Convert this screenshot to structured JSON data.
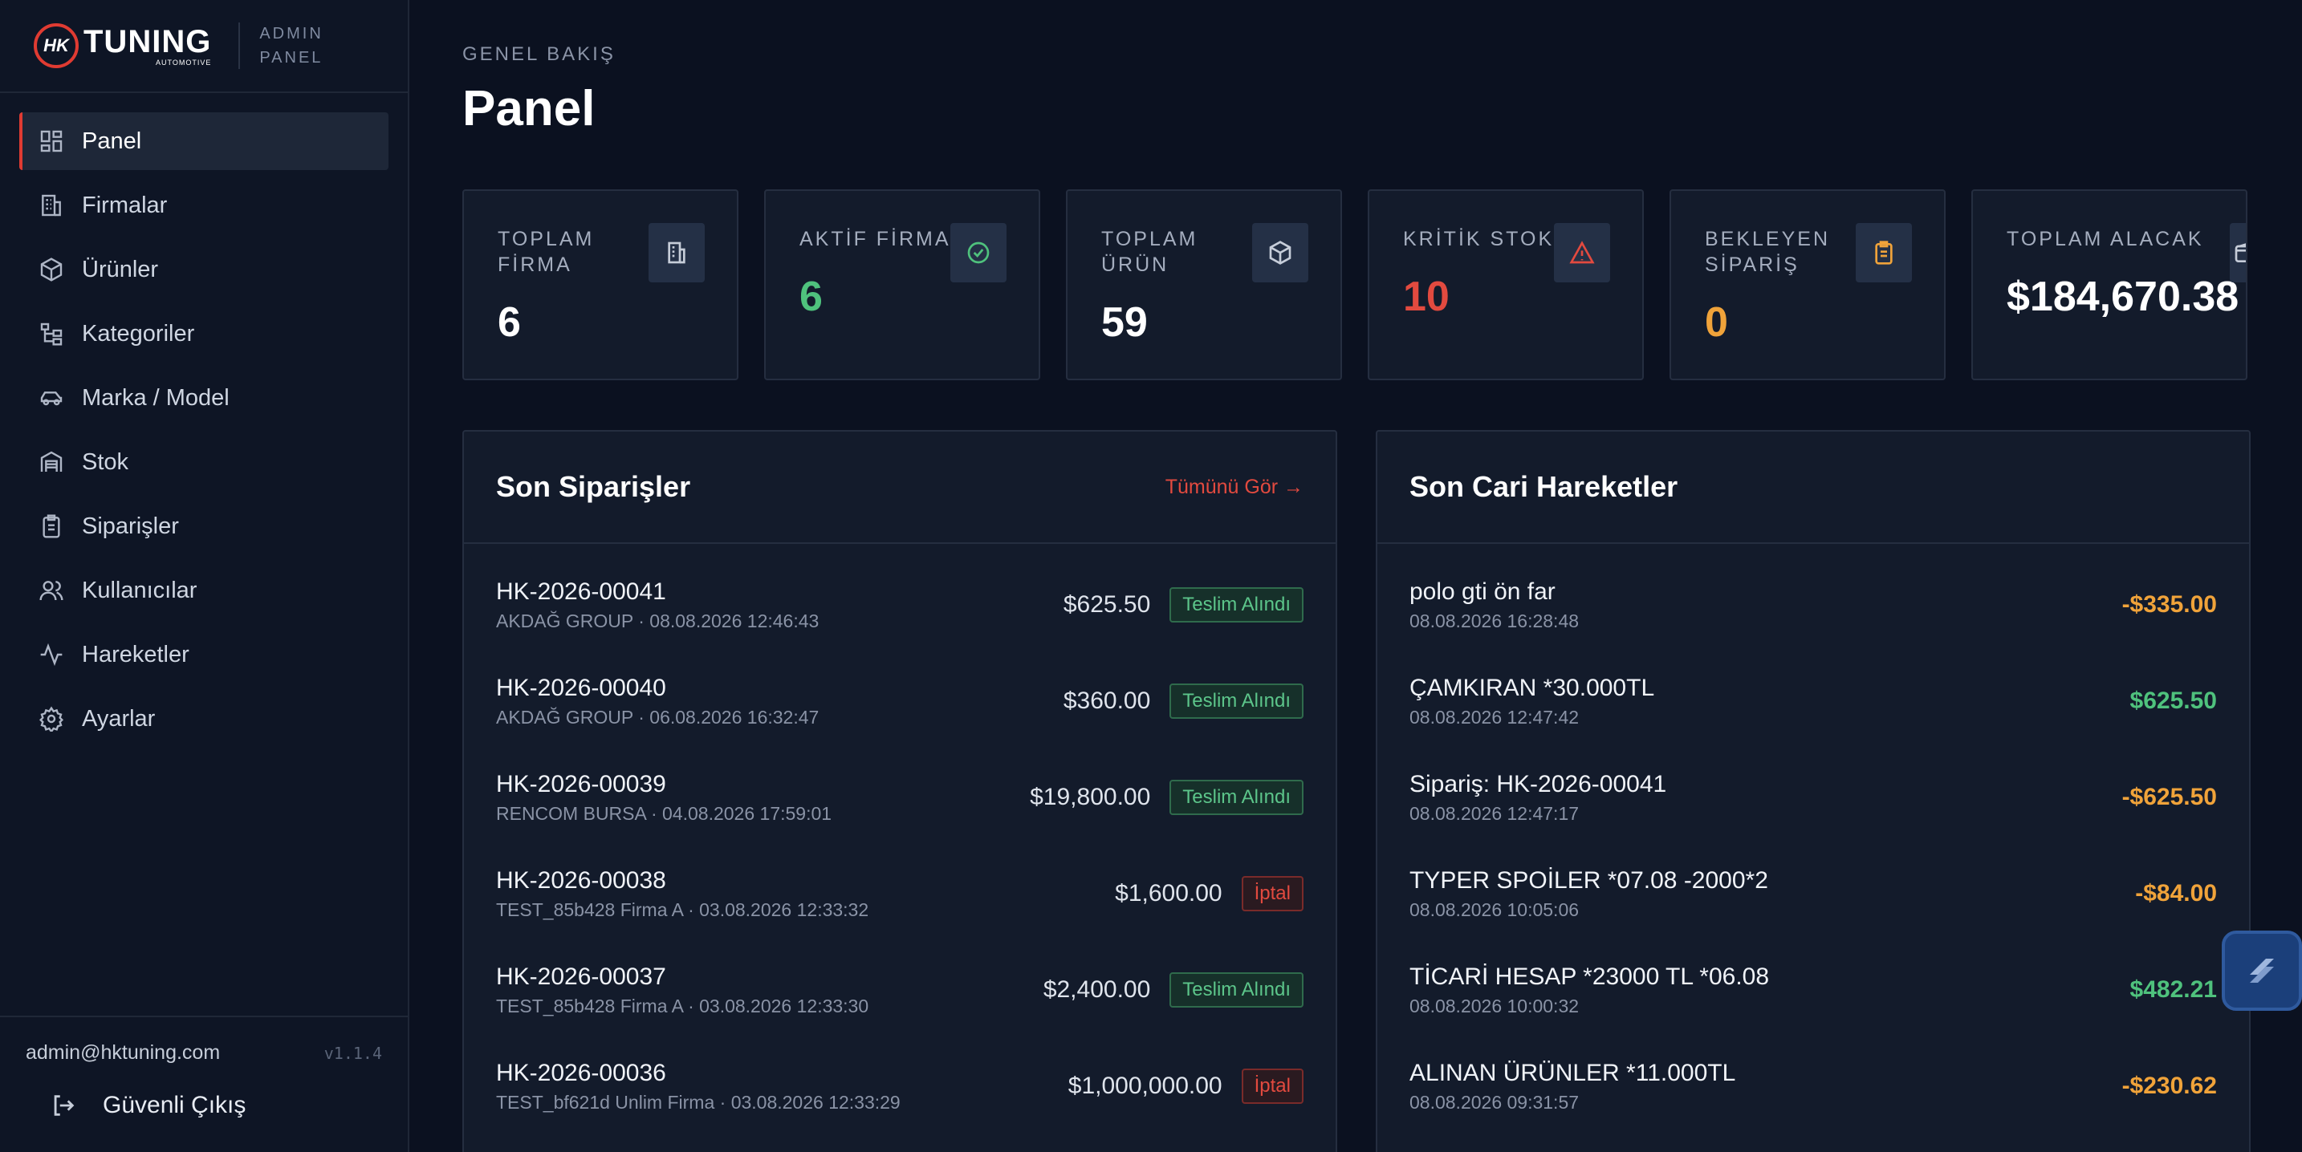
{
  "brand": {
    "logo_mark": "HK",
    "logo_text": "TUNING",
    "logo_sub": "AUTOMOTIVE",
    "caption_line1": "ADMIN",
    "caption_line2": "PANEL",
    "accent": "#e03b32"
  },
  "sidebar": {
    "items": [
      {
        "label": "Panel",
        "icon": "dashboard-icon",
        "active": true
      },
      {
        "label": "Firmalar",
        "icon": "building-icon"
      },
      {
        "label": "Ürünler",
        "icon": "box-icon"
      },
      {
        "label": "Kategoriler",
        "icon": "category-tree-icon"
      },
      {
        "label": "Marka / Model",
        "icon": "car-icon"
      },
      {
        "label": "Stok",
        "icon": "warehouse-icon"
      },
      {
        "label": "Siparişler",
        "icon": "clipboard-icon"
      },
      {
        "label": "Kullanıcılar",
        "icon": "users-icon"
      },
      {
        "label": "Hareketler",
        "icon": "activity-icon"
      },
      {
        "label": "Ayarlar",
        "icon": "gear-icon"
      }
    ],
    "user_email": "admin@hktuning.com",
    "version": "v1.1.4",
    "logout_label": "Güvenli Çıkış"
  },
  "header": {
    "breadcrumb": "GENEL BAKIŞ",
    "title": "Panel"
  },
  "stats": [
    {
      "label": "TOPLAM FİRMA",
      "value": "6",
      "color": "#ffffff",
      "icon": "building-icon"
    },
    {
      "label": "AKTİF FİRMA",
      "value": "6",
      "color": "#4fc27d",
      "icon": "check-circle-icon"
    },
    {
      "label": "TOPLAM ÜRÜN",
      "value": "59",
      "color": "#ffffff",
      "icon": "box-icon"
    },
    {
      "label": "KRİTİK STOK",
      "value": "10",
      "color": "#e24a3f",
      "icon": "warning-icon"
    },
    {
      "label": "BEKLEYEN SİPARİŞ",
      "value": "0",
      "color": "#f0a33a",
      "icon": "clipboard-icon"
    },
    {
      "label": "TOPLAM ALACAK",
      "value": "$184,670.38",
      "color": "#ffffff",
      "icon": "wallet-icon"
    }
  ],
  "orders": {
    "title": "Son Siparişler",
    "link": "Tümünü Gör →",
    "rows": [
      {
        "id": "HK-2026-00041",
        "sub": "AKDAĞ GROUP · 08.08.2026 12:46:43",
        "amount": "$625.50",
        "status": "Teslim Alındı",
        "kind": "ok"
      },
      {
        "id": "HK-2026-00040",
        "sub": "AKDAĞ GROUP · 06.08.2026 16:32:47",
        "amount": "$360.00",
        "status": "Teslim Alındı",
        "kind": "ok"
      },
      {
        "id": "HK-2026-00039",
        "sub": "RENCOM BURSA · 04.08.2026 17:59:01",
        "amount": "$19,800.00",
        "status": "Teslim Alındı",
        "kind": "ok"
      },
      {
        "id": "HK-2026-00038",
        "sub": "TEST_85b428 Firma A · 03.08.2026 12:33:32",
        "amount": "$1,600.00",
        "status": "İptal",
        "kind": "cancel"
      },
      {
        "id": "HK-2026-00037",
        "sub": "TEST_85b428 Firma A · 03.08.2026 12:33:30",
        "amount": "$2,400.00",
        "status": "Teslim Alındı",
        "kind": "ok"
      },
      {
        "id": "HK-2026-00036",
        "sub": "TEST_bf621d Unlim Firma · 03.08.2026 12:33:29",
        "amount": "$1,000,000.00",
        "status": "İptal",
        "kind": "cancel"
      }
    ]
  },
  "transactions": {
    "title": "Son Cari Hareketler",
    "rows": [
      {
        "desc": "polo gti ön far",
        "date": "08.08.2026 16:28:48",
        "amount": "-$335.00",
        "kind": "neg"
      },
      {
        "desc": "ÇAMKIRAN *30.000TL",
        "date": "08.08.2026 12:47:42",
        "amount": "$625.50",
        "kind": "pos"
      },
      {
        "desc": "Sipariş: HK-2026-00041",
        "date": "08.08.2026 12:47:17",
        "amount": "-$625.50",
        "kind": "neg"
      },
      {
        "desc": "TYPER SPOİLER *07.08 -2000*2",
        "date": "08.08.2026 10:05:06",
        "amount": "-$84.00",
        "kind": "neg"
      },
      {
        "desc": "TİCARİ HESAP *23000 TL *06.08",
        "date": "08.08.2026 10:00:32",
        "amount": "$482.21",
        "kind": "pos"
      },
      {
        "desc": "ALINAN ÜRÜNLER *11.000TL",
        "date": "08.08.2026 09:31:57",
        "amount": "-$230.62",
        "kind": "neg"
      }
    ]
  }
}
